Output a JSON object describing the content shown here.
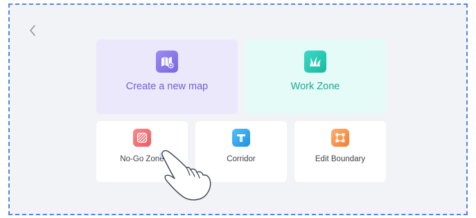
{
  "colors": {
    "frame_border": "#4f86e8",
    "create_card_bg": "#ece8fb",
    "create_text": "#6f5fd6",
    "work_card_bg": "#e4fbf8",
    "work_text": "#1ca891",
    "nogo_icon": "#f0646a",
    "corridor_icon": "#2fa4ee",
    "boundary_icon": "#fb8f3c"
  },
  "nav": {
    "back_icon": "chevron-left-icon"
  },
  "cards": {
    "create_map": {
      "label": "Create a new map",
      "icon": "map-plus-icon"
    },
    "work_zone": {
      "label": "Work Zone",
      "icon": "grass-icon"
    },
    "no_go_zone": {
      "label": "No-Go Zone",
      "icon": "no-go-zone-icon"
    },
    "corridor": {
      "label": "Corridor",
      "icon": "corridor-icon"
    },
    "edit_boundary": {
      "label": "Edit Boundary",
      "icon": "edit-boundary-icon"
    }
  },
  "overlay": {
    "icon": "tap-hand-icon"
  }
}
